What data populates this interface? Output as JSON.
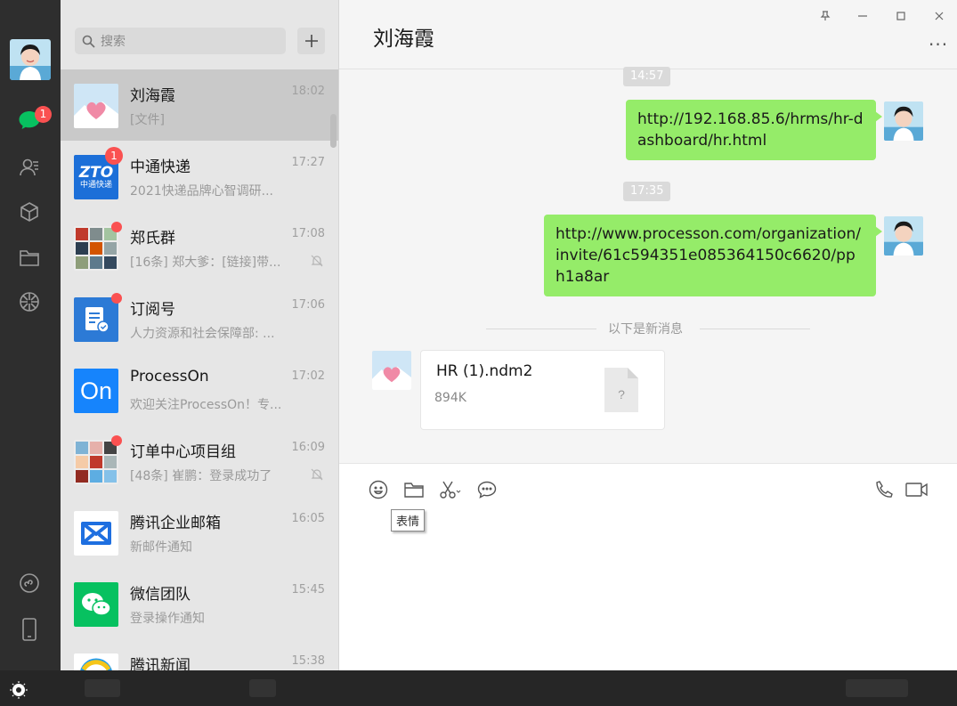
{
  "nav": {
    "unread_badge": "1"
  },
  "search": {
    "placeholder": "搜索"
  },
  "chats": [
    {
      "name": "刘海霞",
      "time": "18:02",
      "preview": "[文件]"
    },
    {
      "name": "中通快递",
      "time": "17:27",
      "preview": "2021快递品牌心智调研...",
      "badge": "1",
      "logo_text": "ZTO",
      "logo_sub": "中通快递"
    },
    {
      "name": "郑氏群",
      "time": "17:08",
      "preview": "[16条] 郑大爹：[链接]带..."
    },
    {
      "name": "订阅号",
      "time": "17:06",
      "preview": "人力资源和社会保障部: ..."
    },
    {
      "name": "ProcessOn",
      "time": "17:02",
      "preview": "欢迎关注ProcessOn！专...",
      "logo_text": "On"
    },
    {
      "name": "订单中心项目组",
      "time": "16:09",
      "preview": "[48条] 崔鹏：登录成功了"
    },
    {
      "name": "腾讯企业邮箱",
      "time": "16:05",
      "preview": "新邮件通知"
    },
    {
      "name": "微信团队",
      "time": "15:45",
      "preview": "登录操作通知"
    },
    {
      "name": "腾讯新闻",
      "time": "15:38",
      "preview": ""
    }
  ],
  "conversation": {
    "title": "刘海霞",
    "timestamps": [
      "14:57",
      "17:35"
    ],
    "messages": [
      {
        "text": "http://192.168.85.6/hrms/hr-dashboard/hr.html"
      },
      {
        "text": "http://www.processon.com/organization/invite/61c594351e085364150c6620/pph1a8ar"
      }
    ],
    "new_divider": "以下是新消息",
    "file": {
      "name": "HR (1).ndm2",
      "size": "894K",
      "glyph": "?"
    }
  },
  "input": {
    "tooltip": "表情"
  },
  "colors": {
    "bubble": "#95ec69",
    "badge": "#fa5151",
    "nav_bg": "#2e2e2e",
    "wechat_green": "#07c160",
    "processon_blue": "#1684fc",
    "zto_blue": "#1c6fd8"
  }
}
